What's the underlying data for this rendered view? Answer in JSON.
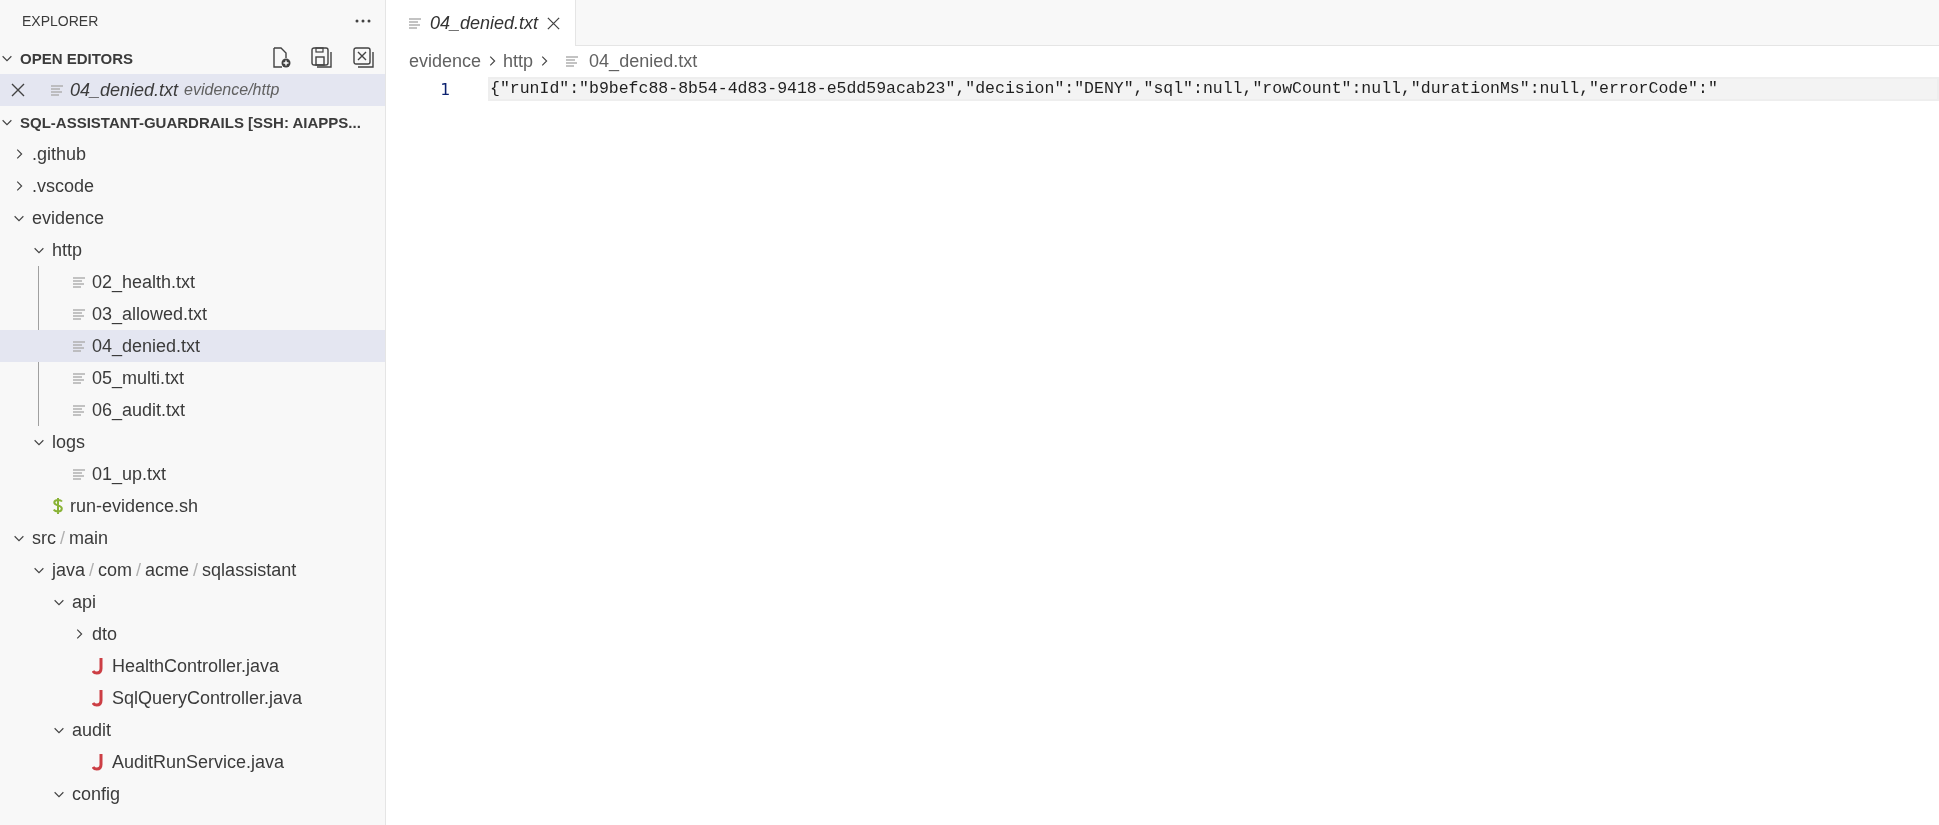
{
  "sidebar": {
    "title": "EXPLORER",
    "open_editors": {
      "title": "OPEN EDITORS",
      "expanded": true,
      "items": [
        {
          "name": "04_denied.txt",
          "description": "evidence/http",
          "kind": "text-file",
          "preview": true,
          "selected": true
        }
      ]
    },
    "workspace": {
      "title": "SQL-ASSISTANT-GUARDRAILS [SSH: AIAPPS...",
      "expanded": true,
      "separator": "/",
      "items": [
        {
          "kind": "folder",
          "segments": [
            ".github"
          ],
          "expanded": false,
          "selected": false
        },
        {
          "kind": "folder",
          "segments": [
            ".vscode"
          ],
          "expanded": false,
          "selected": false
        },
        {
          "kind": "folder",
          "segments": [
            "evidence"
          ],
          "expanded": true,
          "selected": false,
          "children": [
            {
              "kind": "folder",
              "segments": [
                "http"
              ],
              "expanded": true,
              "selected": false,
              "children": [
                {
                  "kind": "text-file",
                  "segments": [
                    "02_health.txt"
                  ],
                  "selected": false
                },
                {
                  "kind": "text-file",
                  "segments": [
                    "03_allowed.txt"
                  ],
                  "selected": false
                },
                {
                  "kind": "text-file",
                  "segments": [
                    "04_denied.txt"
                  ],
                  "selected": true
                },
                {
                  "kind": "text-file",
                  "segments": [
                    "05_multi.txt"
                  ],
                  "selected": false
                },
                {
                  "kind": "text-file",
                  "segments": [
                    "06_audit.txt"
                  ],
                  "selected": false
                }
              ]
            },
            {
              "kind": "folder",
              "segments": [
                "logs"
              ],
              "expanded": true,
              "selected": false,
              "children": [
                {
                  "kind": "text-file",
                  "segments": [
                    "01_up.txt"
                  ],
                  "selected": false
                }
              ]
            },
            {
              "kind": "shell-file",
              "segments": [
                "run-evidence.sh"
              ],
              "selected": false
            }
          ]
        },
        {
          "kind": "folder",
          "segments": [
            "src",
            "main"
          ],
          "expanded": true,
          "selected": false,
          "children": [
            {
              "kind": "folder",
              "segments": [
                "java",
                "com",
                "acme",
                "sqlassistant"
              ],
              "expanded": true,
              "selected": false,
              "children": [
                {
                  "kind": "folder",
                  "segments": [
                    "api"
                  ],
                  "expanded": true,
                  "selected": false,
                  "children": [
                    {
                      "kind": "folder",
                      "segments": [
                        "dto"
                      ],
                      "expanded": false,
                      "selected": false
                    },
                    {
                      "kind": "java-file",
                      "segments": [
                        "HealthController.java"
                      ],
                      "selected": false
                    },
                    {
                      "kind": "java-file",
                      "segments": [
                        "SqlQueryController.java"
                      ],
                      "selected": false
                    }
                  ]
                },
                {
                  "kind": "folder",
                  "segments": [
                    "audit"
                  ],
                  "expanded": true,
                  "selected": false,
                  "children": [
                    {
                      "kind": "java-file",
                      "segments": [
                        "AuditRunService.java"
                      ],
                      "selected": false
                    }
                  ]
                },
                {
                  "kind": "folder",
                  "segments": [
                    "config"
                  ],
                  "expanded": true,
                  "selected": false
                }
              ]
            }
          ]
        }
      ]
    }
  },
  "tabs": [
    {
      "label": "04_denied.txt",
      "preview": true,
      "selected": true
    }
  ],
  "breadcrumbs": [
    "evidence",
    "http",
    "04_denied.txt"
  ],
  "editor": {
    "lines": [
      {
        "number": "1",
        "text": "{\"runId\":\"b9befc88-8b54-4d83-9418-e5dd59acab23\",\"decision\":\"DENY\",\"sql\":null,\"rowCount\":null,\"durationMs\":null,\"errorCode\":\"",
        "current": true
      }
    ]
  }
}
